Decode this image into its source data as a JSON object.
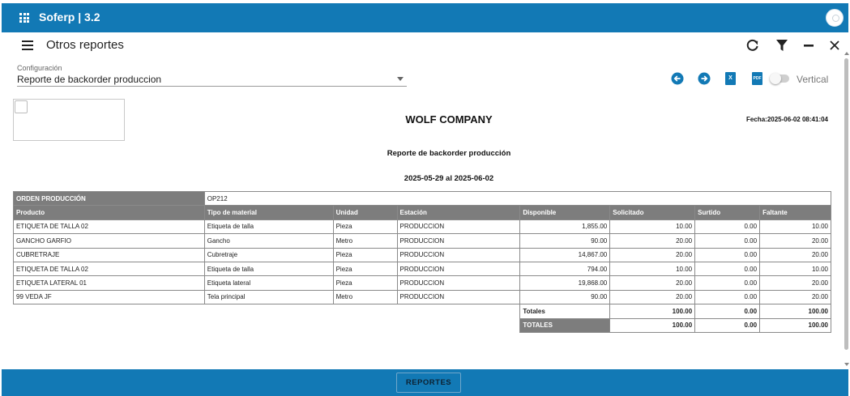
{
  "app": {
    "title": "Soferp | 3.2"
  },
  "page": {
    "title": "Otros reportes"
  },
  "config": {
    "label": "Configuración",
    "value": "Reporte de backorder produccion"
  },
  "toolbar": {
    "orientation_label": "Vertical",
    "orientation_on": false,
    "excel_glyph": "X",
    "pdf_glyph": "PDF"
  },
  "report": {
    "company": "WOLF COMPANY",
    "date": "Fecha:2025-06-02 08:41:04",
    "title": "Reporte de backorder producción",
    "range": "2025-05-29 al 2025-06-02",
    "order_label": "ORDEN PRODUCCIÓN",
    "order_value": "OP212",
    "columns": [
      "Producto",
      "Tipo de material",
      "Unidad",
      "Estación",
      "Disponible",
      "Solicitado",
      "Surtido",
      "Faltante"
    ],
    "rows": [
      [
        "ETIQUETA DE TALLA 02",
        "Etiqueta de talla",
        "Pieza",
        "PRODUCCION",
        "1,855.00",
        "10.00",
        "0.00",
        "10.00"
      ],
      [
        "GANCHO GARFIO",
        "Gancho",
        "Metro",
        "PRODUCCION",
        "90.00",
        "20.00",
        "0.00",
        "20.00"
      ],
      [
        "CUBRETRAJE",
        "Cubretraje",
        "Pieza",
        "PRODUCCION",
        "14,867.00",
        "20.00",
        "0.00",
        "20.00"
      ],
      [
        "ETIQUETA DE TALLA 02",
        "Etiqueta de talla",
        "Pieza",
        "PRODUCCION",
        "794.00",
        "10.00",
        "0.00",
        "10.00"
      ],
      [
        "ETIQUETA LATERAL 01",
        "Etiqueta lateral",
        "Pieza",
        "PRODUCCION",
        "19,868.00",
        "20.00",
        "0.00",
        "20.00"
      ],
      [
        "99 VEDA JF",
        "Tela principal",
        "Metro",
        "PRODUCCION",
        "90.00",
        "20.00",
        "0.00",
        "20.00"
      ]
    ],
    "totals": {
      "label": "Totales",
      "solicitado": "100.00",
      "surtido": "0.00",
      "faltante": "100.00"
    },
    "grand_totals": {
      "label": "TOTALES",
      "solicitado": "100.00",
      "surtido": "0.00",
      "faltante": "100.00"
    }
  },
  "footer": {
    "button_label": "REPORTES"
  },
  "colors": {
    "primary": "#1279b5",
    "table_header": "#7d7d7d"
  }
}
